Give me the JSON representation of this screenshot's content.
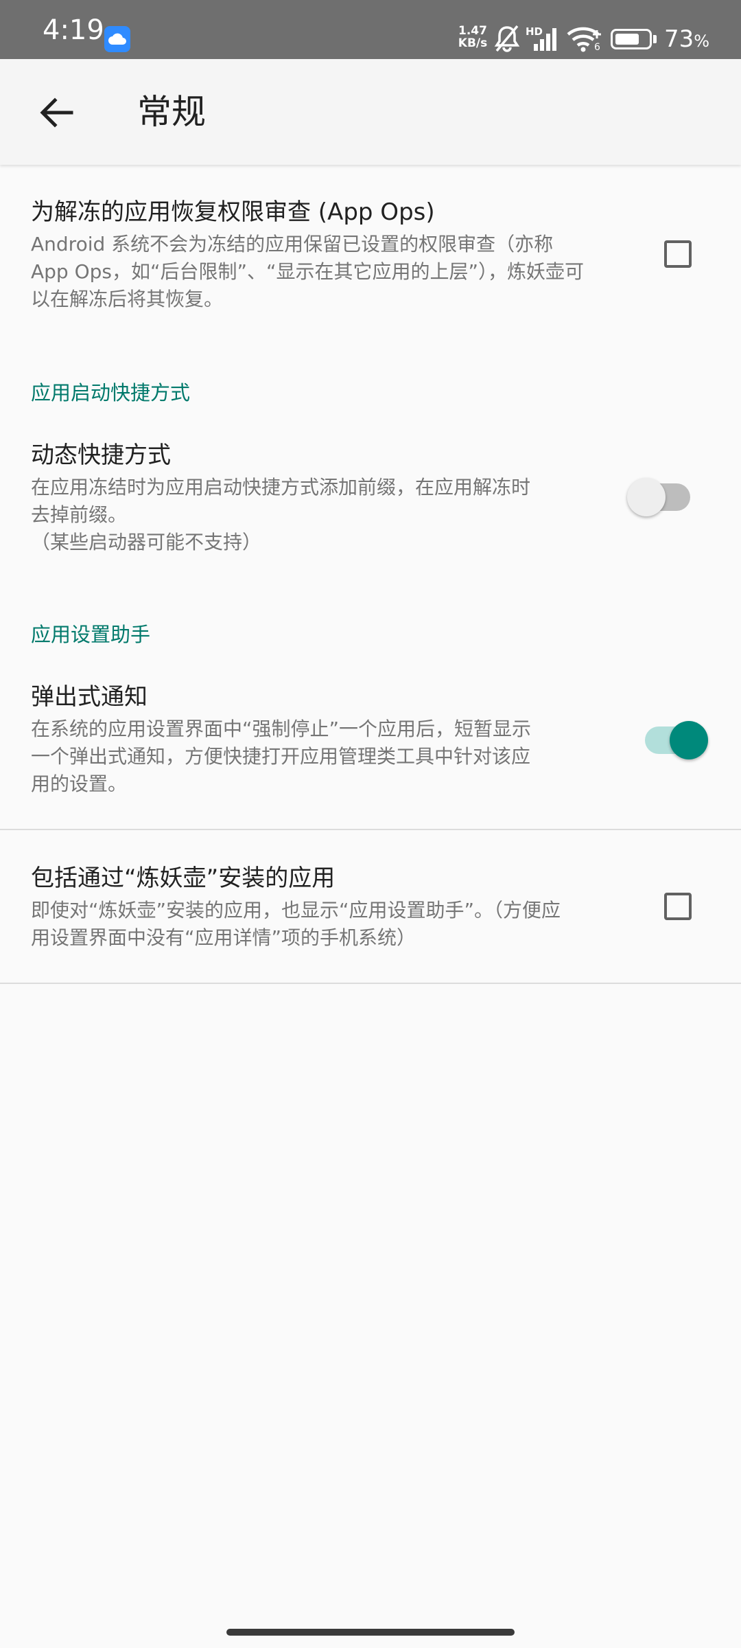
{
  "status_bar": {
    "time": "4:19",
    "net_speed_value": "1.47",
    "net_speed_unit": "KB/s",
    "network_label": "HD",
    "wifi_badge": "6",
    "battery_percent": "73",
    "battery_percent_sign": "%",
    "battery_level": 0.73
  },
  "app_bar": {
    "title": "常规"
  },
  "preferences": {
    "app_ops": {
      "title": "为解冻的应用恢复权限审查 (App Ops)",
      "summary": "Android 系统不会为冻结的应用保留已设置的权限审查（亦称\nApp Ops，如“后台限制”、“显示在其它应用的上层”），炼妖壶可\n以在解冻后将其恢复。",
      "checked": false
    },
    "shortcuts_category": "应用启动快捷方式",
    "dynamic_shortcuts": {
      "title": "动态快捷方式",
      "summary": "在应用冻结时为应用启动快捷方式添加前缀，在应用解冻时\n去掉前缀。\n（某些启动器可能不支持）",
      "enabled": false
    },
    "assistant_category": "应用设置助手",
    "popup_notification": {
      "title": "弹出式通知",
      "summary": "在系统的应用设置界面中“强制停止”一个应用后，短暂显示\n一个弹出式通知，方便快捷打开应用管理类工具中针对该应\n用的设置。",
      "enabled": true
    },
    "include_island_apps": {
      "title": "包括通过“炼妖壶”安装的应用",
      "summary": "即使对“炼妖壶”安装的应用，也显示“应用设置助手”。（方便应\n用设置界面中没有“应用详情”项的手机系统）",
      "checked": false
    }
  },
  "colors": {
    "accent": "#00796b",
    "switch_on_thumb": "#00897b",
    "switch_on_track": "#b2dfdb",
    "switch_off_thumb": "#eeeeee",
    "switch_off_track": "#bdbdbd"
  }
}
